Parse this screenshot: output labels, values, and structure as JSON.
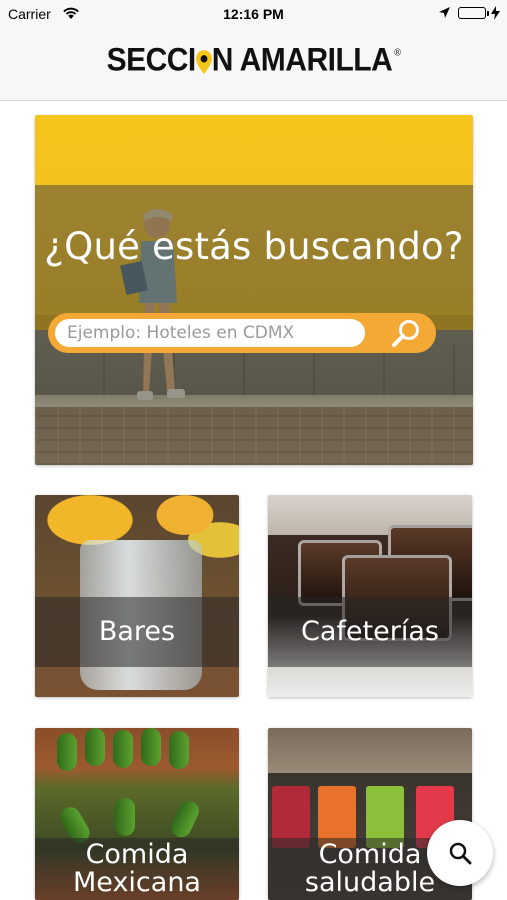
{
  "status_bar": {
    "carrier": "Carrier",
    "time": "12:16 PM",
    "battery_level": 1.0,
    "icons": [
      "wifi-icon",
      "location-arrow-icon",
      "battery-icon",
      "charging-bolt-icon"
    ],
    "battery_color": "#3dc34a"
  },
  "header": {
    "logo_part1": "SECCI",
    "logo_part2": "N AMARILLA",
    "logo_mark": "®",
    "logo_pin_color": "#f5c518"
  },
  "hero": {
    "title": "¿Qué estás buscando?",
    "search_placeholder": "Ejemplo: Hoteles en CDMX",
    "search_value": "",
    "accent_color": "#f4a935"
  },
  "categories": [
    {
      "label": "Bares"
    },
    {
      "label": "Cafeterías"
    },
    {
      "label": "Comida Mexicana"
    },
    {
      "label": "Comida saludable"
    }
  ],
  "fab": {
    "icon": "search-icon"
  }
}
